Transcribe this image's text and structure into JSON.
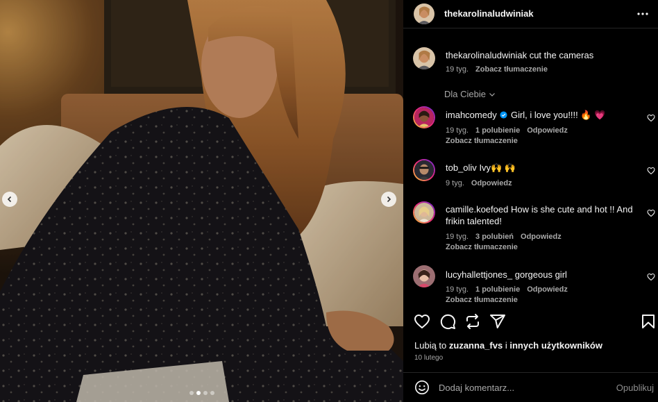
{
  "post": {
    "carousel": {
      "total_slides": 4,
      "active_slide": 2
    },
    "header": {
      "username": "thekarolinaludwiniak"
    },
    "caption": {
      "username": "thekarolinaludwiniak",
      "text": "cut the cameras",
      "age": "19 tyg.",
      "translate": "Zobacz tłumaczenie"
    },
    "filter_label": "Dla Ciebie",
    "comments": [
      {
        "username": "imahcomedy",
        "verified": true,
        "text": "Girl, i love you!!!! 🔥 💗",
        "age": "19 tyg.",
        "likes": "1 polubienie",
        "reply": "Odpowiedz",
        "translate": "Zobacz tłumaczenie"
      },
      {
        "username": "tob_oliv",
        "text": "Ivy🙌 🙌",
        "age": "9 tyg.",
        "reply": "Odpowiedz"
      },
      {
        "username": "camille.koefoed",
        "text": "How is she cute and hot !! And frikin talented!",
        "age": "19 tyg.",
        "likes": "3 polubień",
        "reply": "Odpowiedz",
        "translate": "Zobacz tłumaczenie"
      },
      {
        "username": "lucyhallettjones_",
        "text": "gorgeous girl",
        "age": "19 tyg.",
        "likes": "1 polubienie",
        "reply": "Odpowiedz",
        "translate": "Zobacz tłumaczenie"
      }
    ],
    "likes_line": {
      "prefix": "Lubią to",
      "user": "zuzanna_fvs",
      "joiner": "i",
      "others": "innych użytkowników"
    },
    "date": "10 lutego",
    "add_comment": {
      "placeholder": "Dodaj komentarz...",
      "post_label": "Opublikuj"
    },
    "icons": {
      "like": "heart-icon",
      "comment": "comment-icon",
      "repost": "repost-icon",
      "share": "share-icon",
      "save": "bookmark-icon",
      "more": "more-icon",
      "emoji": "emoji-icon"
    },
    "colors": {
      "accent_heart": "#e0245e",
      "verified": "#0095f6",
      "muted": "#a8a8a8"
    }
  }
}
